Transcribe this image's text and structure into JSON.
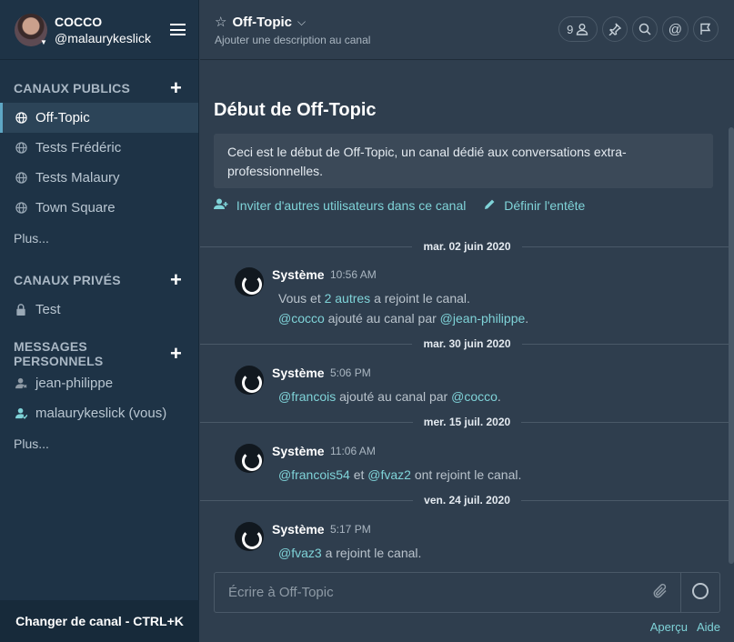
{
  "team": {
    "name": "COCCO",
    "user": "@malaurykeslick"
  },
  "sidebar": {
    "public_header": "CANAUX PUBLICS",
    "public_channels": [
      {
        "label": "Off-Topic",
        "icon": "globe-icon",
        "active": true
      },
      {
        "label": "Tests Frédéric",
        "icon": "globe-icon"
      },
      {
        "label": "Tests Malaury",
        "icon": "globe-icon"
      },
      {
        "label": "Town Square",
        "icon": "globe-icon"
      }
    ],
    "public_more": "Plus...",
    "private_header": "CANAUX PRIVÉS",
    "private_channels": [
      {
        "label": "Test",
        "icon": "lock-icon"
      }
    ],
    "dm_header": "MESSAGES PERSONNELS",
    "dms": [
      {
        "label": "jean-philippe",
        "icon": "user-away-icon"
      },
      {
        "label": "malaurykeslick (vous)",
        "icon": "user-online-icon"
      }
    ],
    "dm_more": "Plus...",
    "switcher": "Changer de canal - CTRL+K"
  },
  "channel": {
    "name": "Off-Topic",
    "description": "Ajouter une description au canal",
    "member_count": "9",
    "intro_title": "Début de Off-Topic",
    "intro_text": "Ceci est le début de Off-Topic, un canal dédié aux conversations extra-professionnelles.",
    "invite_link": "Inviter d'autres utilisateurs dans ce canal",
    "header_link": "Définir l'entête"
  },
  "posts": [
    {
      "date": "mar. 02 juin 2020",
      "author": "Système",
      "time": "10:56 AM",
      "line1": {
        "pre": "Vous et ",
        "mention": "2 autres",
        "post": " a rejoint le canal."
      },
      "line2": {
        "m1": "@cocco",
        "mid": " ajouté au canal par ",
        "m2": "@jean-philippe",
        "end": "."
      }
    },
    {
      "date": "mar. 30 juin 2020",
      "author": "Système",
      "time": "5:06 PM",
      "line1": {
        "m1": "@francois",
        "mid": " ajouté au canal par ",
        "m2": "@cocco",
        "end": "."
      }
    },
    {
      "date": "mer. 15 juil. 2020",
      "author": "Système",
      "time": "11:06 AM",
      "line1": {
        "m1": "@francois54",
        "mid": " et ",
        "m2": "@fvaz2",
        "end": " ont rejoint le canal."
      }
    },
    {
      "date": "ven. 24 juil. 2020",
      "author": "Système",
      "time": "5:17 PM",
      "line1": {
        "m1": "@fvaz3",
        "mid": " a rejoint le canal.",
        "m2": "",
        "end": ""
      }
    }
  ],
  "composer": {
    "placeholder": "Écrire à Off-Topic"
  },
  "footer": {
    "preview": "Aperçu",
    "help": "Aide"
  }
}
